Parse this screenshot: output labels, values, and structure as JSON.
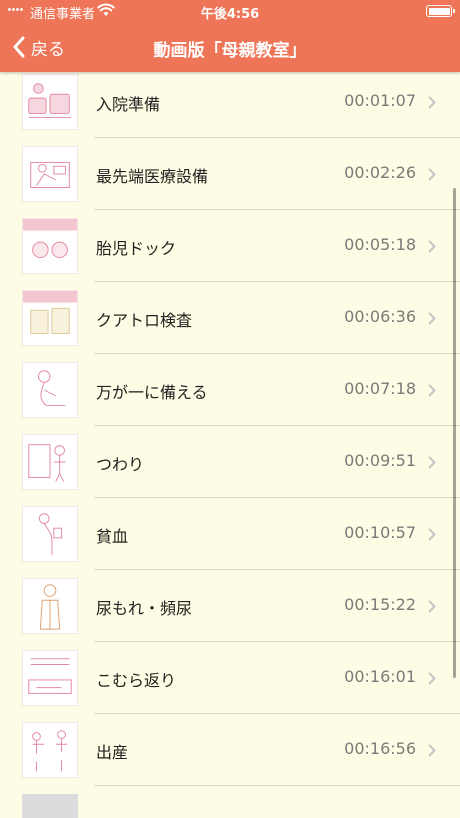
{
  "status_bar": {
    "carrier": "通信事業者",
    "time": "午後4:56"
  },
  "nav": {
    "back_label": "戻る",
    "title": "動画版「母親教室」"
  },
  "colors": {
    "header": "#ee7557",
    "background": "#fdfce4",
    "thumb_line": "#e48aa0"
  },
  "videos": [
    {
      "title": "入院準備",
      "duration": "00:01:07"
    },
    {
      "title": "最先端医療設備",
      "duration": "00:02:26"
    },
    {
      "title": "胎児ドック",
      "duration": "00:05:18"
    },
    {
      "title": "クアトロ検査",
      "duration": "00:06:36"
    },
    {
      "title": "万が一に備える",
      "duration": "00:07:18"
    },
    {
      "title": "つわり",
      "duration": "00:09:51"
    },
    {
      "title": "貧血",
      "duration": "00:10:57"
    },
    {
      "title": "尿もれ・頻尿",
      "duration": "00:15:22"
    },
    {
      "title": "こむら返り",
      "duration": "00:16:01"
    },
    {
      "title": "出産",
      "duration": "00:16:56"
    }
  ]
}
